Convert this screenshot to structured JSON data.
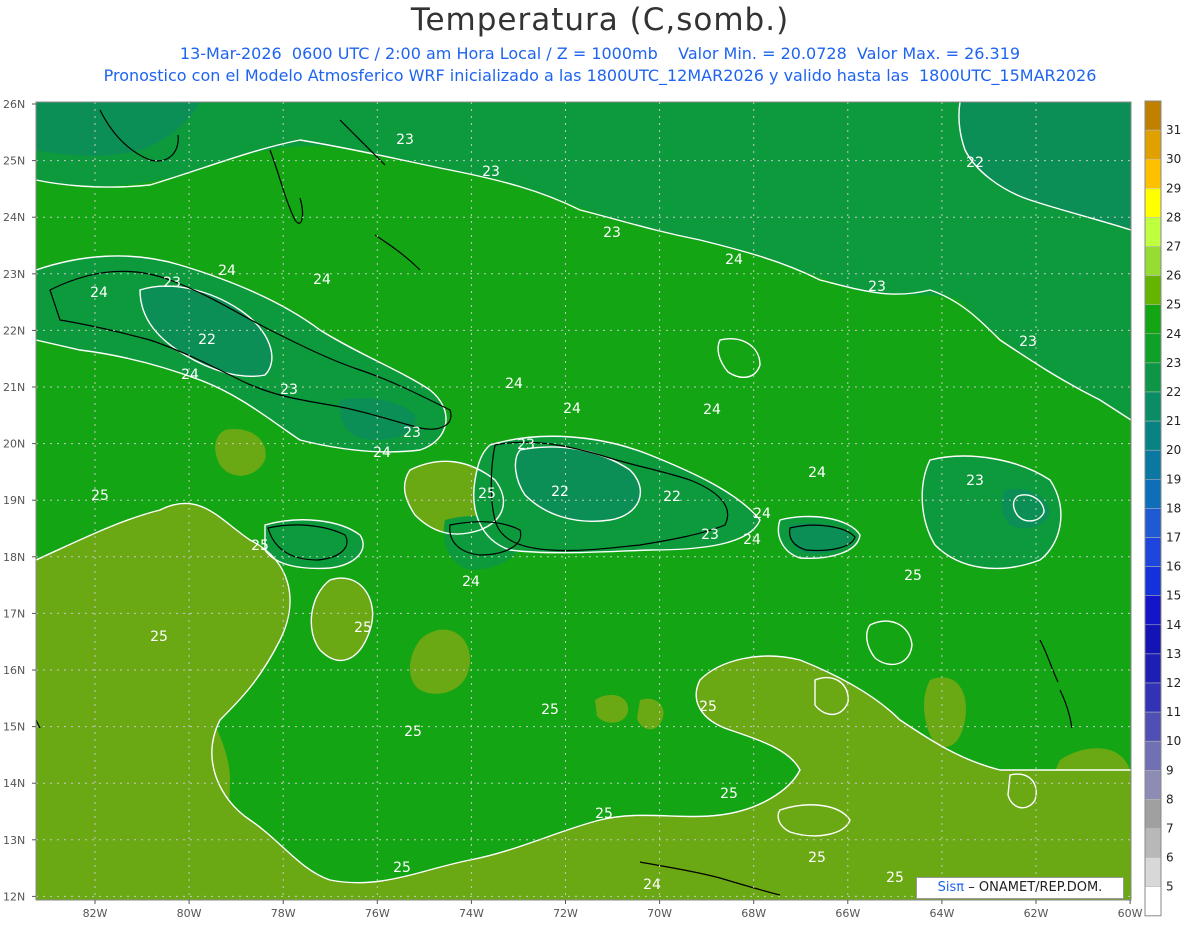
{
  "header": {
    "title": "Temperatura (C,somb.)",
    "subtitle_line1": "13-Mar-2026  0600 UTC / 2:00 am Hora Local / Z = 1000mb    Valor Min. = 20.0728  Valor Max. = 26.319",
    "subtitle_line2": "Pronostico con el Modelo Atmosferico WRF inicializado a las 1800UTC_12MAR2026 y valido hasta las  1800UTC_15MAR2026"
  },
  "map": {
    "lat_labels": [
      "26N",
      "25N",
      "24N",
      "23N",
      "22N",
      "21N",
      "20N",
      "19N",
      "18N",
      "17N",
      "16N",
      "15N",
      "14N",
      "13N",
      "12N"
    ],
    "lon_labels": [
      "82W",
      "80W",
      "78W",
      "76W",
      "74W",
      "72W",
      "70W",
      "68W",
      "66W",
      "64W",
      "62W",
      "60W"
    ],
    "contour_labels": [
      {
        "text": "23"
      },
      {
        "text": "23"
      },
      {
        "text": "22"
      },
      {
        "text": "23"
      },
      {
        "text": "24"
      },
      {
        "text": "24"
      },
      {
        "text": "24"
      },
      {
        "text": "23"
      },
      {
        "text": "23"
      },
      {
        "text": "22"
      },
      {
        "text": "24"
      },
      {
        "text": "23"
      },
      {
        "text": "23"
      },
      {
        "text": "24"
      },
      {
        "text": "24"
      },
      {
        "text": "24"
      },
      {
        "text": "24"
      },
      {
        "text": "23"
      },
      {
        "text": "24"
      },
      {
        "text": "23"
      },
      {
        "text": "22"
      },
      {
        "text": "22"
      },
      {
        "text": "23"
      },
      {
        "text": "24"
      },
      {
        "text": "24"
      },
      {
        "text": "24"
      },
      {
        "text": "23"
      },
      {
        "text": "25"
      },
      {
        "text": "25"
      },
      {
        "text": "25"
      },
      {
        "text": "24"
      },
      {
        "text": "25"
      },
      {
        "text": "25"
      },
      {
        "text": "25"
      },
      {
        "text": "25"
      },
      {
        "text": "25"
      },
      {
        "text": "25"
      },
      {
        "text": "25"
      },
      {
        "text": "25"
      },
      {
        "text": "25"
      },
      {
        "text": "25"
      },
      {
        "text": "25"
      },
      {
        "text": "24"
      }
    ],
    "colors": {
      "base_24": "#14a514",
      "zone_25": "#6aa814",
      "zone_23": "#0c9a3c",
      "zone_22": "#0c8f56",
      "contour": "#ffffff",
      "coast": "#000000",
      "grid": "#c8c8c8"
    }
  },
  "colorbar": {
    "labels": [
      "31",
      "30",
      "29",
      "28",
      "27",
      "26",
      "25",
      "24",
      "23",
      "22",
      "21",
      "20",
      "19",
      "18",
      "17",
      "16",
      "15",
      "14",
      "13",
      "12",
      "11",
      "10",
      "9",
      "8",
      "7",
      "6",
      "5"
    ],
    "colors": [
      "#c08000",
      "#e0a000",
      "#ffc000",
      "#ffff00",
      "#c0ff40",
      "#96dc32",
      "#64b400",
      "#14a514",
      "#0fa028",
      "#0c9646",
      "#0a8c64",
      "#088282",
      "#0a78a0",
      "#0f6eb9",
      "#1e5ad2",
      "#1e46dc",
      "#1432dc",
      "#1414c8",
      "#1414b4",
      "#1e1eb4",
      "#3232b4",
      "#5050b4",
      "#7070b4",
      "#8c8cb4",
      "#a0a0a0",
      "#b8b8b8",
      "#d8d8d8",
      "#ffffff"
    ]
  },
  "credit": {
    "brand": "Sisπ",
    "org": "– ONAMET/REP.DOM."
  }
}
